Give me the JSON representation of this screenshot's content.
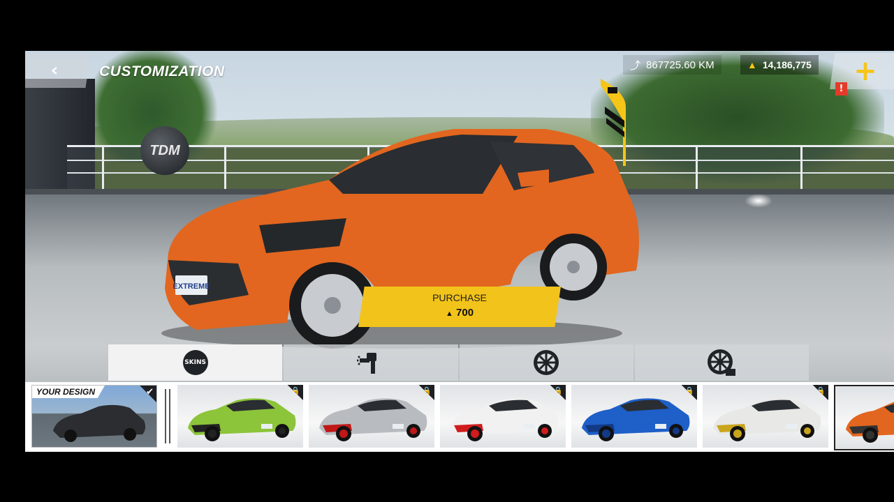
{
  "header": {
    "back_icon": "chevron-left-icon",
    "title": "CUSTOMIZATION",
    "distance": "867725.60 KM",
    "currency": "14,186,775",
    "plus_icon": "plus-icon",
    "alert": "!"
  },
  "logo": {
    "text": "TDM"
  },
  "purchase": {
    "label": "PURCHASE",
    "price": "700",
    "currency_icon": "coin-icon"
  },
  "car": {
    "plate": "EXTREME",
    "color": "#e2661f"
  },
  "tabs": [
    {
      "label": "SKINS",
      "icon": "skins-icon",
      "active": true
    },
    {
      "icon": "spray-gun-icon"
    },
    {
      "icon": "wheel-icon"
    },
    {
      "icon": "wheel-settings-icon"
    }
  ],
  "skins": {
    "your_design": {
      "label": "YOUR DESIGN",
      "check_icon": "check-icon"
    },
    "items": [
      {
        "color": "#8cc43a",
        "accent": "#222",
        "locked": true
      },
      {
        "color": "#b8bcc0",
        "accent": "#c01818",
        "locked": true
      },
      {
        "color": "#f1f1f1",
        "accent": "#d01c1c",
        "locked": true
      },
      {
        "color": "#1e5fc8",
        "accent": "#133a85",
        "locked": true
      },
      {
        "color": "#e8e8e6",
        "accent": "#c9a51c",
        "locked": true
      },
      {
        "color": "#e2661f",
        "accent": "#333",
        "locked": false
      }
    ]
  },
  "colors": {
    "accent": "#f2c31a",
    "alert": "#e53b2a"
  }
}
